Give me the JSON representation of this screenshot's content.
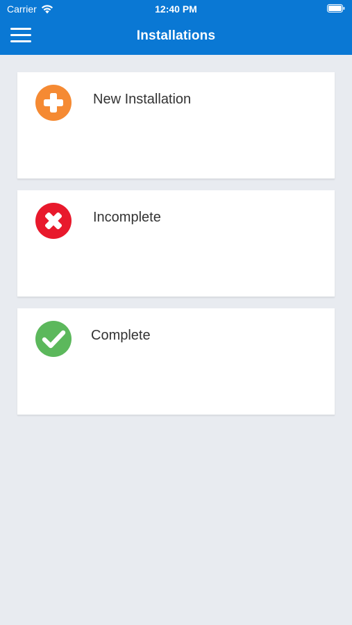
{
  "status_bar": {
    "carrier": "Carrier",
    "time": "12:40 PM"
  },
  "header": {
    "title": "Installations",
    "background_color": "#0a78d4"
  },
  "cards": [
    {
      "label": "New Installation",
      "icon": "plus-circle-icon",
      "color": "#f58a33"
    },
    {
      "label": "Incomplete",
      "icon": "x-circle-icon",
      "color": "#e8192c"
    },
    {
      "label": "Complete",
      "icon": "check-circle-icon",
      "color": "#5cb85c"
    }
  ]
}
